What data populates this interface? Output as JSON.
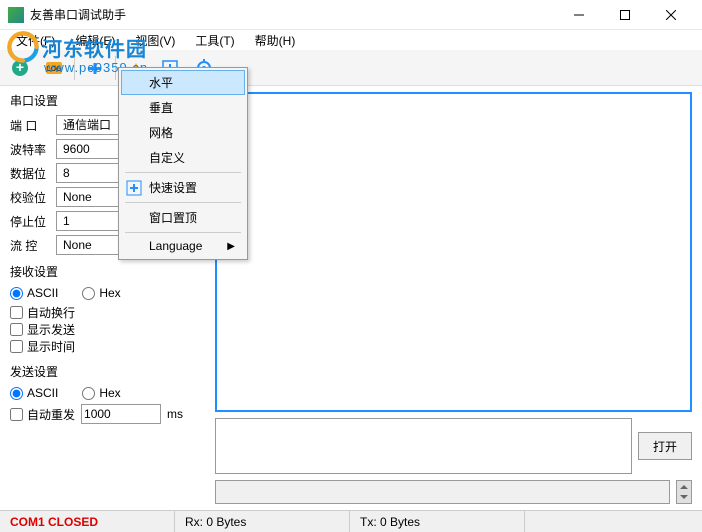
{
  "window": {
    "title": "友善串口调试助手"
  },
  "watermark": {
    "brand": "河东软件园",
    "url": "www.pc0359.cn"
  },
  "menu": {
    "file": "文件(F)",
    "edit": "编辑(E)",
    "view": "视图(V)",
    "tools": "工具(T)",
    "help": "帮助(H)"
  },
  "view_dropdown": {
    "horizontal": "水平",
    "vertical": "垂直",
    "grid": "网格",
    "custom": "自定义",
    "quick_settings": "快速设置",
    "window_top": "窗口置顶",
    "language": "Language"
  },
  "serial_section": {
    "title": "串口设置",
    "port_label": "端 口",
    "port_value": "通信端口",
    "baud_label": "波特率",
    "baud_value": "9600",
    "data_label": "数据位",
    "data_value": "8",
    "parity_label": "校验位",
    "parity_value": "None",
    "stop_label": "停止位",
    "stop_value": "1",
    "flow_label": "流 控",
    "flow_value": "None"
  },
  "recv_section": {
    "title": "接收设置",
    "ascii": "ASCII",
    "hex": "Hex",
    "autowrap": "自动换行",
    "showsend": "显示发送",
    "showtime": "显示时间"
  },
  "send_section": {
    "title": "发送设置",
    "ascii": "ASCII",
    "hex": "Hex",
    "autorepeat": "自动重发",
    "interval": "1000",
    "unit": "ms"
  },
  "buttons": {
    "open": "打开"
  },
  "status": {
    "port": "COM1 CLOSED",
    "rx": "Rx: 0 Bytes",
    "tx": "Tx: 0 Bytes"
  }
}
